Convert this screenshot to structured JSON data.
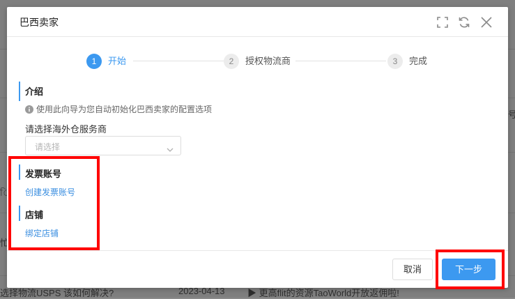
{
  "background": {
    "texts": [
      {
        "text": "号"
      },
      {
        "text": "ি,"
      },
      {
        "text": "忙"
      },
      {
        "text": "选择物流USPS 该如何解决?"
      },
      {
        "text": "2023-04-13"
      },
      {
        "text": "▶ 更高flit的资源TaoWorld开放返佣啦!"
      }
    ]
  },
  "dialog": {
    "title": "巴西卖家",
    "steps": [
      {
        "number": "1",
        "label": "开始",
        "state": "active"
      },
      {
        "number": "2",
        "label": "授权物流商",
        "state": "pending"
      },
      {
        "number": "3",
        "label": "完成",
        "state": "pending"
      }
    ],
    "intro": {
      "heading": "介绍",
      "info_text": "使用此向导为您自动初始化巴西卖家的配置选项",
      "provider_label": "请选择海外仓服务商",
      "provider_select": {
        "placeholder": "请选择",
        "value": ""
      }
    },
    "invoice": {
      "heading": "发票账号",
      "link": "创建发票账号"
    },
    "store": {
      "heading": "店铺",
      "link": "绑定店铺"
    },
    "footer": {
      "cancel_label": "取消",
      "next_label": "下一步"
    }
  },
  "colors": {
    "accent": "#3c99f0",
    "highlight": "#ff0000"
  }
}
